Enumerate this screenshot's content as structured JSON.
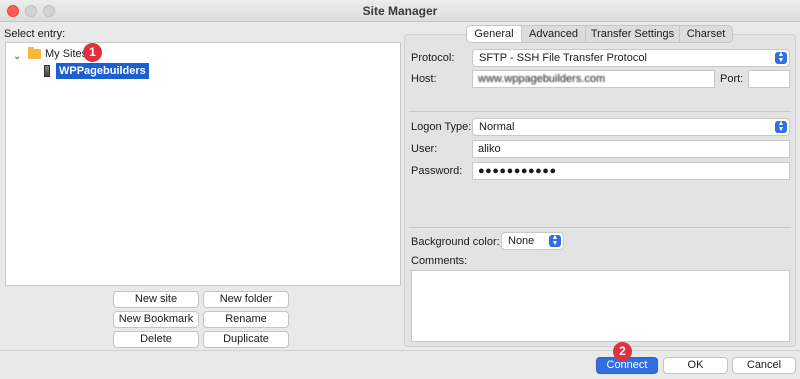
{
  "window": {
    "title": "Site Manager"
  },
  "left": {
    "select_entry_label": "Select entry:",
    "tree": {
      "folder_label": "My Sites",
      "site_label": "WPPagebuilders"
    },
    "buttons": {
      "new_site": "New site",
      "new_folder": "New folder",
      "new_bookmark": "New Bookmark",
      "rename": "Rename",
      "delete": "Delete",
      "duplicate": "Duplicate"
    }
  },
  "tabs": [
    "General",
    "Advanced",
    "Transfer Settings",
    "Charset"
  ],
  "general": {
    "protocol_label": "Protocol:",
    "protocol_value": "SFTP - SSH File Transfer Protocol",
    "host_label": "Host:",
    "host_value": "www.wppagebuilders.com",
    "port_label": "Port:",
    "port_value": "",
    "logon_type_label": "Logon Type:",
    "logon_type_value": "Normal",
    "user_label": "User:",
    "user_value": "aliko",
    "password_label": "Password:",
    "password_value": "●●●●●●●●●●●",
    "bg_color_label": "Background color:",
    "bg_color_value": "None",
    "comments_label": "Comments:",
    "comments_value": ""
  },
  "footer": {
    "connect": "Connect",
    "ok": "OK",
    "cancel": "Cancel"
  },
  "annotations": [
    "1",
    "2"
  ],
  "colors": {
    "accent": "#2f6fe0",
    "selection": "#1b5fd0",
    "badge": "#e0323c"
  }
}
